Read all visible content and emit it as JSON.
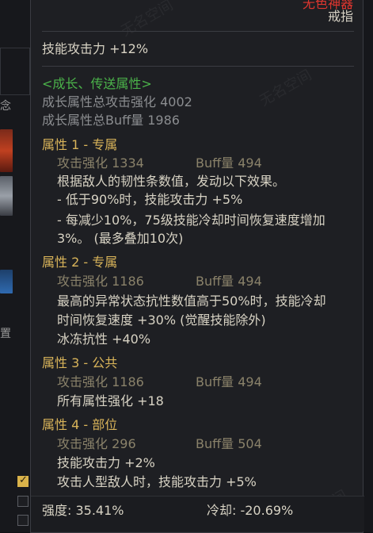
{
  "item": {
    "name": "无色神器",
    "slot": "戒指",
    "skill_attack": "技能攻击力  +12%"
  },
  "growth": {
    "header": "<成长、传送属性>",
    "total_attack": "成长属性总攻击强化 4002",
    "total_buff": "成长属性总Buff量 1986"
  },
  "attributes": [
    {
      "title": "属性 1 - 专属",
      "atk": "攻击强化  1334",
      "buff": "Buff量  494",
      "lines": [
        "根据敌人的韧性条数值，发动以下效果。",
        "- 低于90%时，技能攻击力 +5%",
        "- 每减少10%，75级技能冷却时间恢复速度增加",
        "3%。 (最多叠加10次)"
      ]
    },
    {
      "title": "属性 2 - 专属",
      "atk": "攻击强化  1186",
      "buff": "Buff量  494",
      "lines": [
        "最高的异常状态抗性数值高于50%时，技能冷却",
        "时间恢复速度 +30% (觉醒技能除外)",
        "冰冻抗性 +40%"
      ]
    },
    {
      "title": "属性 3 - 公共",
      "atk": "攻击强化  1186",
      "buff": "Buff量  494",
      "lines": [
        "所有属性强化 +18"
      ]
    },
    {
      "title": "属性 4 - 部位",
      "atk": "攻击强化  296",
      "buff": "Buff量  504",
      "lines": [
        "技能攻击力 +2%",
        "攻击人型敌人时，技能攻击力 +5%"
      ]
    }
  ],
  "footer": {
    "strength": "强度: 35.41%",
    "cooldown": "冷却: -20.69%"
  },
  "left_ui": {
    "char_a": "念",
    "char_b": "置"
  },
  "watermark": "无名空间",
  "colors": {
    "background": "#1e1f23",
    "gold": "#d9b45a",
    "green": "#4bb34a",
    "red": "#e0362f",
    "text": "#d8d3c4",
    "muted": "#8b8d90"
  }
}
